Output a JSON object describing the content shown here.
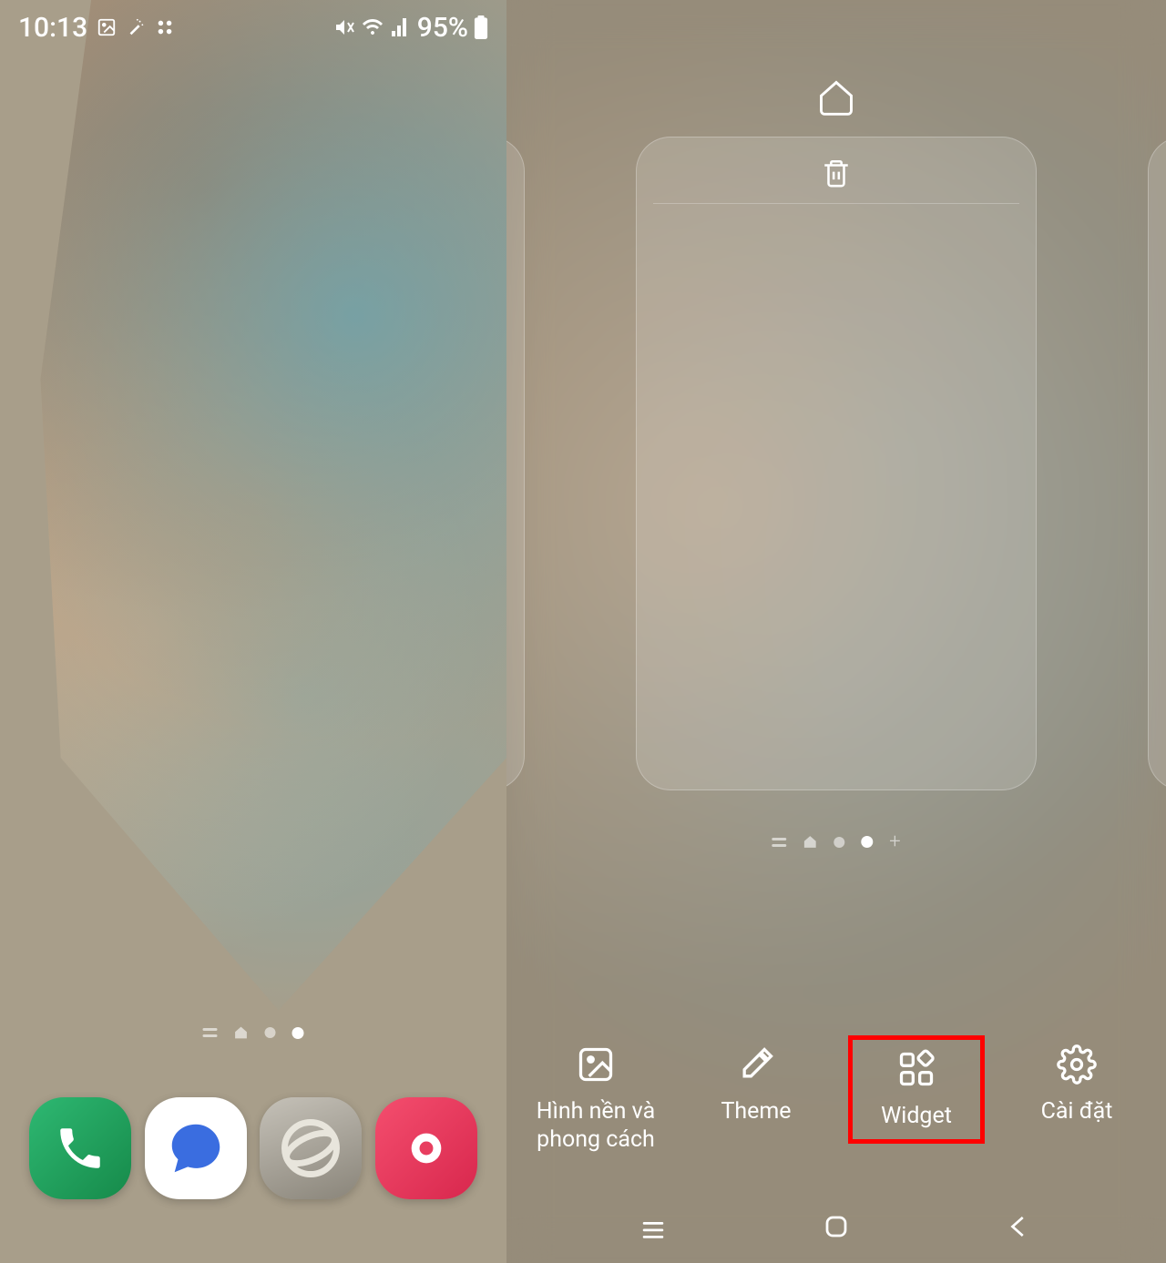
{
  "status_bar": {
    "time": "10:13",
    "battery_percent": "95%",
    "icons": [
      "image-icon",
      "magic-wand-icon",
      "apps-icon",
      "mute-icon",
      "wifi-icon",
      "signal-icon",
      "battery-icon"
    ]
  },
  "dock": {
    "apps": [
      {
        "name": "phone"
      },
      {
        "name": "messages"
      },
      {
        "name": "browser"
      },
      {
        "name": "camera"
      }
    ]
  },
  "edit_mode": {
    "options": [
      {
        "key": "wallpaper",
        "label": "Hình nền và phong cách"
      },
      {
        "key": "theme",
        "label": "Theme"
      },
      {
        "key": "widget",
        "label": "Widget"
      },
      {
        "key": "settings",
        "label": "Cài đặt"
      }
    ],
    "highlighted_option": "widget"
  },
  "nav": {
    "buttons": [
      "recents",
      "home",
      "back"
    ]
  }
}
